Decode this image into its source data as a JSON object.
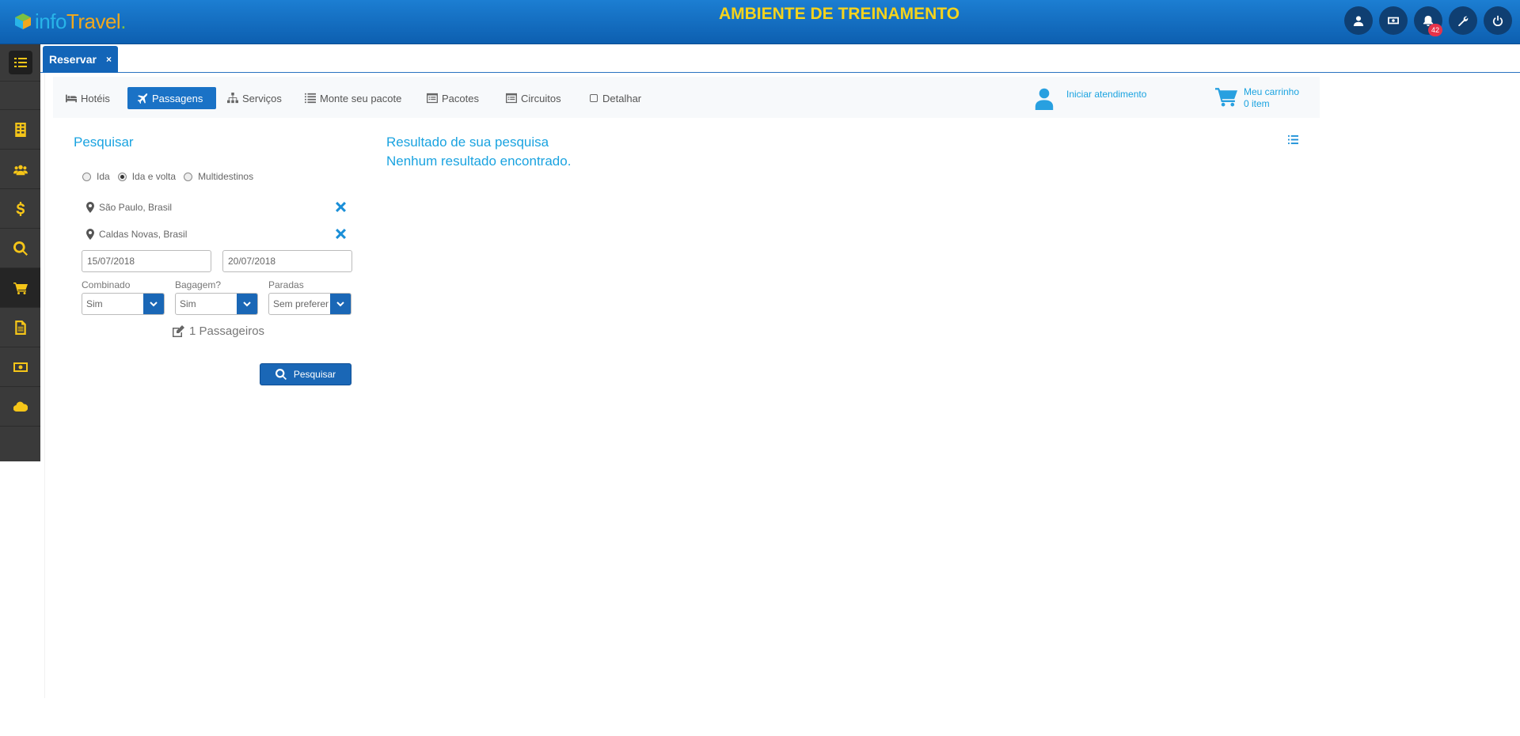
{
  "header": {
    "logo": {
      "part1": "info",
      "part2": "Travel",
      "dot": "."
    },
    "environment_title": "AMBIENTE DE TREINAMENTO",
    "notification_count": "42",
    "buttons": [
      "user-icon",
      "money-icon",
      "bell-icon",
      "wrench-icon",
      "power-icon"
    ]
  },
  "sidebar": {
    "items": [
      "menu-list-icon",
      "building-icon",
      "users-icon",
      "dollar-icon",
      "search-icon",
      "cart-icon",
      "document-icon",
      "cash-icon",
      "cloud-icon"
    ],
    "accent_color": "#f5c518"
  },
  "tabs": {
    "active": {
      "label": "Reservar",
      "close": "×"
    }
  },
  "nav": {
    "items": [
      {
        "label": "Hotéis",
        "icon": "bed-icon"
      },
      {
        "label": "Passagens",
        "icon": "plane-icon",
        "active": true
      },
      {
        "label": "Serviços",
        "icon": "sitemap-icon"
      },
      {
        "label": "Monte seu pacote",
        "icon": "list-icon"
      },
      {
        "label": "Pacotes",
        "icon": "list-alt-icon"
      },
      {
        "label": "Circuitos",
        "icon": "list-alt-icon"
      },
      {
        "label": "Detalhar",
        "icon": "checkbox-icon"
      }
    ],
    "attendance": "Iniciar atendimento",
    "cart": {
      "title": "Meu carrinho",
      "count": "0 item"
    }
  },
  "search": {
    "title": "Pesquisar",
    "trip_types": [
      {
        "label": "Ida",
        "checked": false
      },
      {
        "label": "Ida e volta",
        "checked": true
      },
      {
        "label": "Multidestinos",
        "checked": false
      }
    ],
    "origin": "São Paulo, Brasil",
    "destination": "Caldas Novas, Brasil",
    "departure_date": "15/07/2018",
    "return_date": "20/07/2018",
    "combined": {
      "label": "Combinado",
      "value": "Sim"
    },
    "baggage": {
      "label": "Bagagem?",
      "value": "Sim"
    },
    "stops": {
      "label": "Paradas",
      "value": "Sem preferencia"
    },
    "passengers": "1 Passageiros",
    "button": "Pesquisar"
  },
  "results": {
    "title": "Resultado de sua pesquisa",
    "empty_message": "Nenhum resultado encontrado."
  }
}
